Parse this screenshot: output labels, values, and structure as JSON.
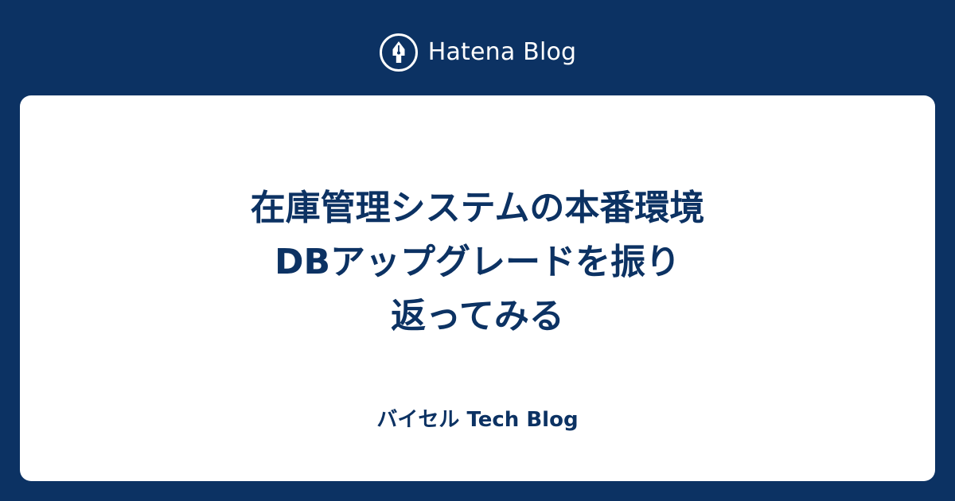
{
  "colors": {
    "background": "#0c3263",
    "card": "#ffffff",
    "text_on_card": "#0c3263",
    "text_on_background": "#ffffff"
  },
  "brand": {
    "logo_icon": "hatena-blog-pen-nib-icon",
    "name": "Hatena Blog"
  },
  "article": {
    "title_lines": [
      "在庫管理システムの本番環境",
      "DBアップグレードを振り",
      "返ってみる"
    ]
  },
  "blog": {
    "name": "バイセル Tech Blog"
  }
}
